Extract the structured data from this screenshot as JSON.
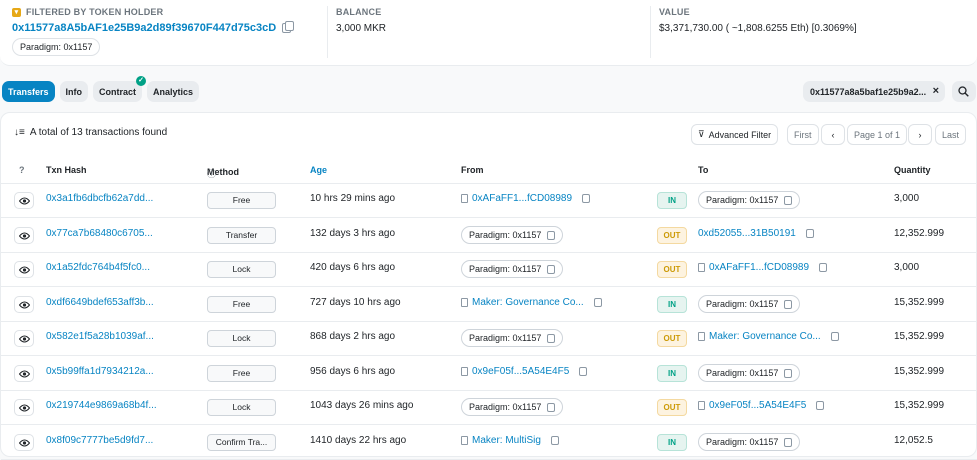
{
  "summary": {
    "filter_label": "FILTERED BY TOKEN HOLDER",
    "holder_address": "0x11577a8A5bAF1e25B9a2d89f39670F447d75c3cD",
    "holder_tag": "Paradigm: 0x1157",
    "balance_label": "BALANCE",
    "balance_value": "3,000 MKR",
    "value_label": "VALUE",
    "value_text": "$3,371,730.00 ( ~1,808.6255 Eth) [0.3069%]"
  },
  "tabs": [
    {
      "label": "Transfers",
      "active": true
    },
    {
      "label": "Info"
    },
    {
      "label": "Contract",
      "verified": true
    },
    {
      "label": "Analytics"
    }
  ],
  "filter_chip": "0x11577a8a5baf1e25b9a2...",
  "table": {
    "total_text": "A total of 13 transactions found",
    "advanced_filter": "Advanced Filter",
    "pager": {
      "first": "First",
      "page": "Page 1 of 1",
      "last": "Last"
    },
    "headers": {
      "hash": "Txn Hash",
      "method": "Method",
      "age": "Age",
      "from": "From",
      "to": "To",
      "qty": "Quantity"
    },
    "rows": [
      {
        "hash": "0x3a1fb6dbcfb62a7dd...",
        "method": "Free",
        "age": "10 hrs 29 mins ago",
        "from": "0xAFaFF1...fCD08989",
        "from_type": "link",
        "dir": "IN",
        "to": "Paradigm: 0x1157",
        "to_type": "pill",
        "qty": "3,000"
      },
      {
        "hash": "0x77ca7b68480c6705...",
        "method": "Transfer",
        "age": "132 days 3 hrs ago",
        "from": "Paradigm: 0x1157",
        "from_type": "pill",
        "dir": "OUT",
        "to": "0xd52055...31B50191",
        "to_type": "plain",
        "qty": "12,352.999"
      },
      {
        "hash": "0x1a52fdc764b4f5fc0...",
        "method": "Lock",
        "age": "420 days 6 hrs ago",
        "from": "Paradigm: 0x1157",
        "from_type": "pill",
        "dir": "OUT",
        "to": "0xAFaFF1...fCD08989",
        "to_type": "link",
        "qty": "3,000"
      },
      {
        "hash": "0xdf6649bdef653aff3b...",
        "method": "Free",
        "age": "727 days 10 hrs ago",
        "from": "Maker: Governance Co...",
        "from_type": "link",
        "dir": "IN",
        "to": "Paradigm: 0x1157",
        "to_type": "pill",
        "qty": "15,352.999"
      },
      {
        "hash": "0x582e1f5a28b1039af...",
        "method": "Lock",
        "age": "868 days 2 hrs ago",
        "from": "Paradigm: 0x1157",
        "from_type": "pill",
        "dir": "OUT",
        "to": "Maker: Governance Co...",
        "to_type": "link",
        "qty": "15,352.999"
      },
      {
        "hash": "0x5b99ffa1d7934212a...",
        "method": "Free",
        "age": "956 days 6 hrs ago",
        "from": "0x9eF05f...5A54E4F5",
        "from_type": "link",
        "dir": "IN",
        "to": "Paradigm: 0x1157",
        "to_type": "pill",
        "qty": "15,352.999"
      },
      {
        "hash": "0x219744e9869a68b4f...",
        "method": "Lock",
        "age": "1043 days 26 mins ago",
        "from": "Paradigm: 0x1157",
        "from_type": "pill",
        "dir": "OUT",
        "to": "0x9eF05f...5A54E4F5",
        "to_type": "link",
        "qty": "15,352.999"
      },
      {
        "hash": "0x8f09c7777be5d9fd7...",
        "method": "Confirm Tra...",
        "age": "1410 days 22 hrs ago",
        "from": "Maker: MultiSig",
        "from_type": "link",
        "dir": "IN",
        "to": "Paradigm: 0x1157",
        "to_type": "pill",
        "qty": "12,052.5"
      }
    ]
  }
}
